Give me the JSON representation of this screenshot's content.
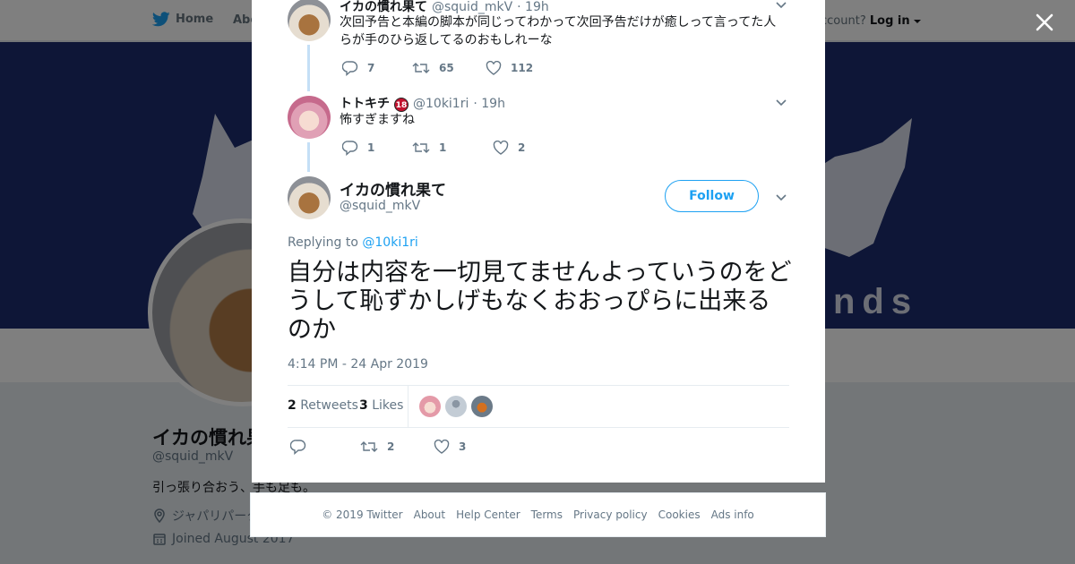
{
  "topnav": {
    "home_label": "Home",
    "about_label": "Abo",
    "account_prompt": "ccount?",
    "login_label": "Log in"
  },
  "banner": {
    "text": "nds"
  },
  "profile": {
    "name": "イカの慣れ果",
    "handle": "@squid_mkV",
    "bio": "引っ張り合おう、手も足も。",
    "location": "ジャパリパーク",
    "joined": "Joined August 2017"
  },
  "thread": {
    "reply1": {
      "name": "イカの慣れ果て",
      "handle": "@squid_mkV",
      "time": "· 19h",
      "text": "次回予告と本編の脚本が同じってわかって次回予告だけが癒しって言ってた人らが手のひら返してるのおもしれーな",
      "replies": "7",
      "retweets": "65",
      "likes": "112"
    },
    "reply2": {
      "name": "トトキチ",
      "badge": "18",
      "handle": "@10ki1ri",
      "time": "· 19h",
      "text": "怖すぎますね",
      "replies": "1",
      "retweets": "1",
      "likes": "2"
    }
  },
  "main_tweet": {
    "name": "イカの慣れ果て",
    "handle": "@squid_mkV",
    "follow_label": "Follow",
    "replying_prefix": "Replying to",
    "replying_handle": "@10ki1ri",
    "text": "自分は内容を一切見てませんよっていうのをどうして恥ずかしげもなくおおっぴらに出来るのか",
    "timestamp": "4:14 PM - 24 Apr 2019",
    "retweet_count": "2",
    "retweet_label": "Retweets",
    "like_count": "3",
    "like_label": "Likes",
    "action_retweets": "2",
    "action_likes": "3"
  },
  "footer": {
    "copyright": "© 2019 Twitter",
    "links": [
      "About",
      "Help Center",
      "Terms",
      "Privacy policy",
      "Cookies",
      "Ads info"
    ]
  },
  "colors": {
    "accent": "#1da1f2",
    "banner": "#1c2d6e",
    "badge_red": "#c3122f"
  },
  "icons": [
    "twitter-bird-icon",
    "close-icon",
    "reply-icon",
    "retweet-icon",
    "heart-icon",
    "chevron-down-icon",
    "location-icon",
    "calendar-icon"
  ]
}
